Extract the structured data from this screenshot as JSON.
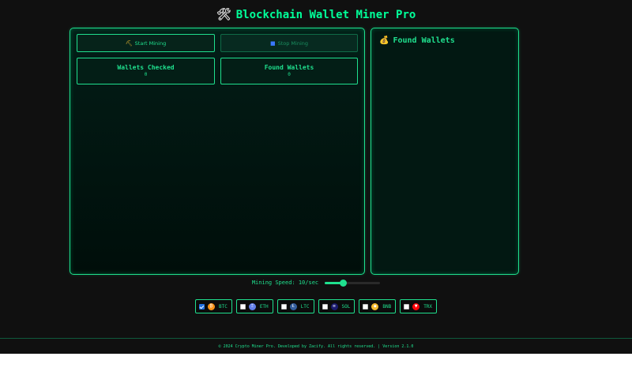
{
  "app": {
    "title": "Blockchain Wallet Miner Pro",
    "tool_icon": "🛠"
  },
  "controls": {
    "start_label": "Start Mining",
    "start_icon": "⛏",
    "stop_label": "Stop Mining",
    "stop_icon": "■"
  },
  "stats": {
    "checked_label": "Wallets Checked",
    "checked_value": "0",
    "found_label": "Found Wallets",
    "found_value": "0"
  },
  "found_panel": {
    "title": "Found Wallets",
    "icon": "💰"
  },
  "speed": {
    "label": "Mining Speed: 10/sec",
    "level_fraction": 0.33
  },
  "coins": [
    {
      "symbol": "BTC",
      "checked": true,
      "color": "#f7931a",
      "glyph": "₿"
    },
    {
      "symbol": "ETH",
      "checked": false,
      "color": "#627eea",
      "glyph": "Ξ"
    },
    {
      "symbol": "LTC",
      "checked": false,
      "color": "#345d9d",
      "glyph": "Ł"
    },
    {
      "symbol": "SOL",
      "checked": false,
      "color": "#1a1a6e",
      "glyph": "≡"
    },
    {
      "symbol": "BNB",
      "checked": false,
      "color": "#f3ba2f",
      "glyph": "◆"
    },
    {
      "symbol": "TRX",
      "checked": false,
      "color": "#ff060a",
      "glyph": "▼"
    }
  ],
  "footer": {
    "text": "© 2024 Crypto Miner Pro. Developed by Zacify. All rights reserved. | Version 2.1.0"
  },
  "colors": {
    "accent": "#1fe08e",
    "background": "#101010"
  }
}
